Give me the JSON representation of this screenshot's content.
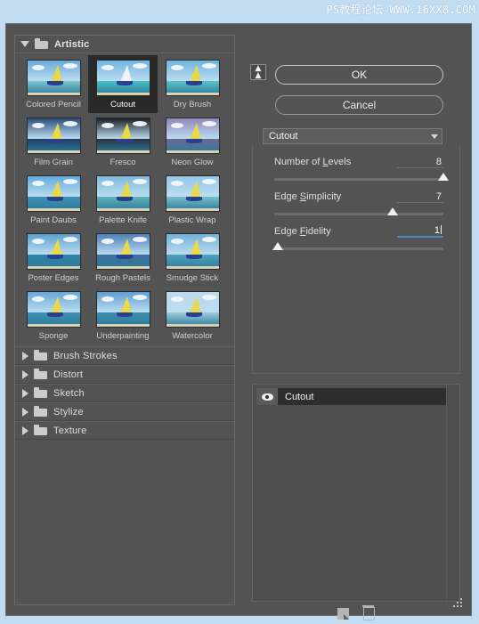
{
  "window": {
    "watermark": "PS教程论坛 WWW.16XX8.COM",
    "background_color": "#535353",
    "frame_color": "#c2dcf2"
  },
  "left_panel": {
    "expanded_category": {
      "label": "Artistic",
      "icon": "folder-open-icon",
      "twisty": "triangle-down-icon"
    },
    "thumbnails": [
      {
        "label": "Colored Pencil",
        "selected": false
      },
      {
        "label": "Cutout",
        "selected": true
      },
      {
        "label": "Dry Brush",
        "selected": false
      },
      {
        "label": "Film Grain",
        "selected": false
      },
      {
        "label": "Fresco",
        "selected": false
      },
      {
        "label": "Neon Glow",
        "selected": false
      },
      {
        "label": "Paint Daubs",
        "selected": false
      },
      {
        "label": "Palette Knife",
        "selected": false
      },
      {
        "label": "Plastic Wrap",
        "selected": false
      },
      {
        "label": "Poster Edges",
        "selected": false
      },
      {
        "label": "Rough Pastels",
        "selected": false
      },
      {
        "label": "Smudge Stick",
        "selected": false
      },
      {
        "label": "Sponge",
        "selected": false
      },
      {
        "label": "Underpainting",
        "selected": false
      },
      {
        "label": "Watercolor",
        "selected": false
      }
    ],
    "collapsed_categories": [
      {
        "label": "Brush Strokes"
      },
      {
        "label": "Distort"
      },
      {
        "label": "Sketch"
      },
      {
        "label": "Stylize"
      },
      {
        "label": "Texture"
      }
    ]
  },
  "right_panel": {
    "collapse_button_icon": "double-chevron-up-icon",
    "ok_label": "OK",
    "cancel_label": "Cancel",
    "filter_select": {
      "value": "Cutout",
      "icon": "chevron-down-icon"
    },
    "sliders": [
      {
        "label_before": "Number of ",
        "label_key": "L",
        "label_after": "evels",
        "value": "8",
        "percent": 100,
        "active": false
      },
      {
        "label_before": "Edge ",
        "label_key": "S",
        "label_after": "implicity",
        "value": "7",
        "percent": 70,
        "active": false
      },
      {
        "label_before": "Edge ",
        "label_key": "F",
        "label_after": "idelity",
        "value": "1",
        "percent": 2,
        "active": true
      }
    ],
    "layer_list": [
      {
        "name": "Cutout",
        "visible": true,
        "visibility_icon": "eye-icon"
      }
    ],
    "toolbar": {
      "new_effect_icon": "new-effect-layer-icon",
      "delete_icon": "trash-icon"
    },
    "resize_grip_icon": "resize-grip-icon"
  }
}
